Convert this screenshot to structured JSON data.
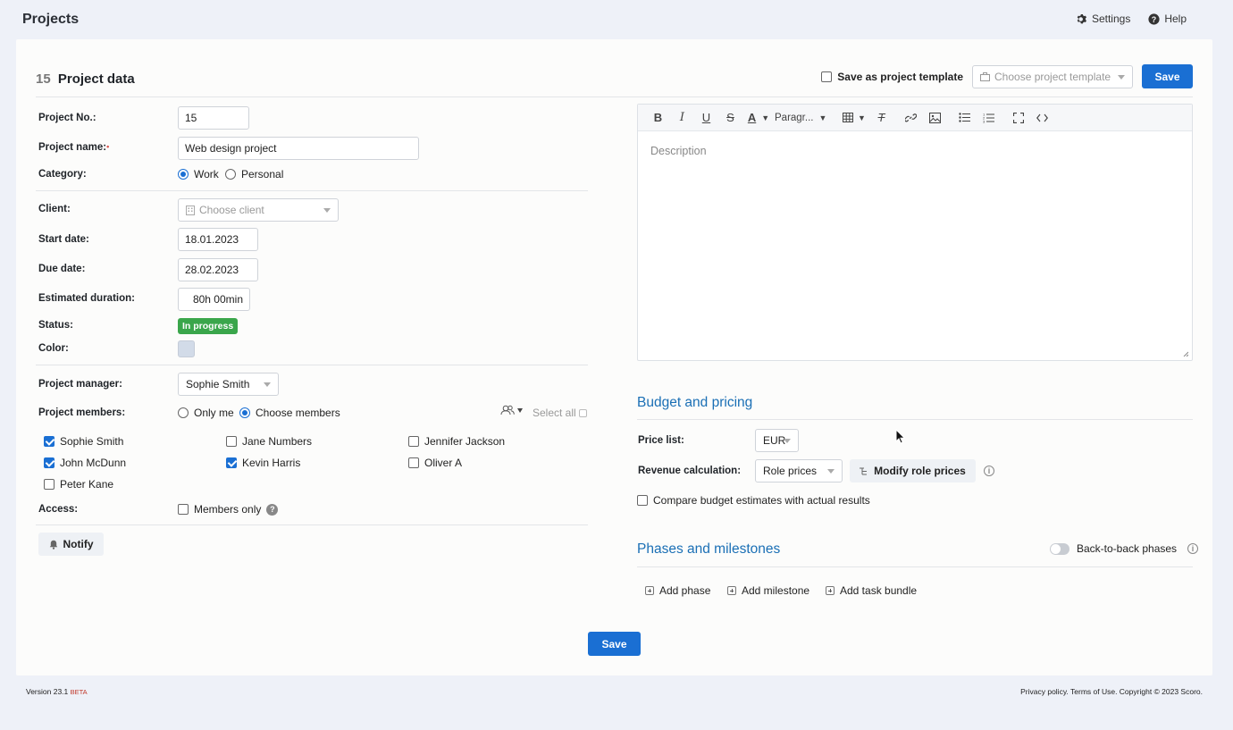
{
  "app": {
    "title": "Projects",
    "settings_label": "Settings",
    "help_label": "Help"
  },
  "header": {
    "project_number": "15",
    "title": "Project data",
    "save_template_label": "Save as project template",
    "template_placeholder": "Choose project template",
    "save_label": "Save"
  },
  "form": {
    "project_no_label": "Project No.:",
    "project_no_value": "15",
    "project_name_label": "Project name:",
    "project_name_value": "Web design project",
    "category_label": "Category:",
    "category_options": [
      "Work",
      "Personal"
    ],
    "category_selected": "Work",
    "client_label": "Client:",
    "client_placeholder": "Choose client",
    "start_date_label": "Start date:",
    "start_date_value": "18.01.2023",
    "due_date_label": "Due date:",
    "due_date_value": "28.02.2023",
    "duration_label": "Estimated duration:",
    "duration_value": "80h 00min",
    "status_label": "Status:",
    "status_value": "In progress",
    "color_label": "Color:",
    "color_value": "#d2dbe8",
    "manager_label": "Project manager:",
    "manager_value": "Sophie Smith",
    "members_label": "Project members:",
    "members_options": [
      "Only me",
      "Choose members"
    ],
    "members_selected": "Choose members",
    "select_all_label": "Select all",
    "members": [
      {
        "name": "Sophie Smith",
        "checked": true
      },
      {
        "name": "Jane Numbers",
        "checked": false
      },
      {
        "name": "Jennifer Jackson",
        "checked": false
      },
      {
        "name": "John McDunn",
        "checked": true
      },
      {
        "name": "Kevin Harris",
        "checked": true
      },
      {
        "name": "Oliver A",
        "checked": false
      },
      {
        "name": "Peter Kane",
        "checked": false
      }
    ],
    "access_label": "Access:",
    "members_only_label": "Members only",
    "notify_label": "Notify"
  },
  "editor": {
    "paragraph_label": "Paragr...",
    "placeholder": "Description"
  },
  "budget": {
    "title": "Budget and pricing",
    "price_list_label": "Price list:",
    "price_list_value": "EUR",
    "revenue_label": "Revenue calculation:",
    "revenue_value": "Role prices",
    "modify_label": "Modify role prices",
    "compare_label": "Compare budget estimates with actual results"
  },
  "phases": {
    "title": "Phases and milestones",
    "back_to_back_label": "Back-to-back phases",
    "add_phase": "Add phase",
    "add_milestone": "Add milestone",
    "add_task_bundle": "Add task bundle"
  },
  "bottom": {
    "save_label": "Save"
  },
  "footer": {
    "version": "Version 23.1",
    "beta": "BETA",
    "legal": "Privacy policy. Terms of Use. Copyright © 2023 Scoro."
  },
  "colors": {
    "primary": "#1a6fd3",
    "status_green": "#3aa64b",
    "section_blue": "#1a6fb5"
  }
}
